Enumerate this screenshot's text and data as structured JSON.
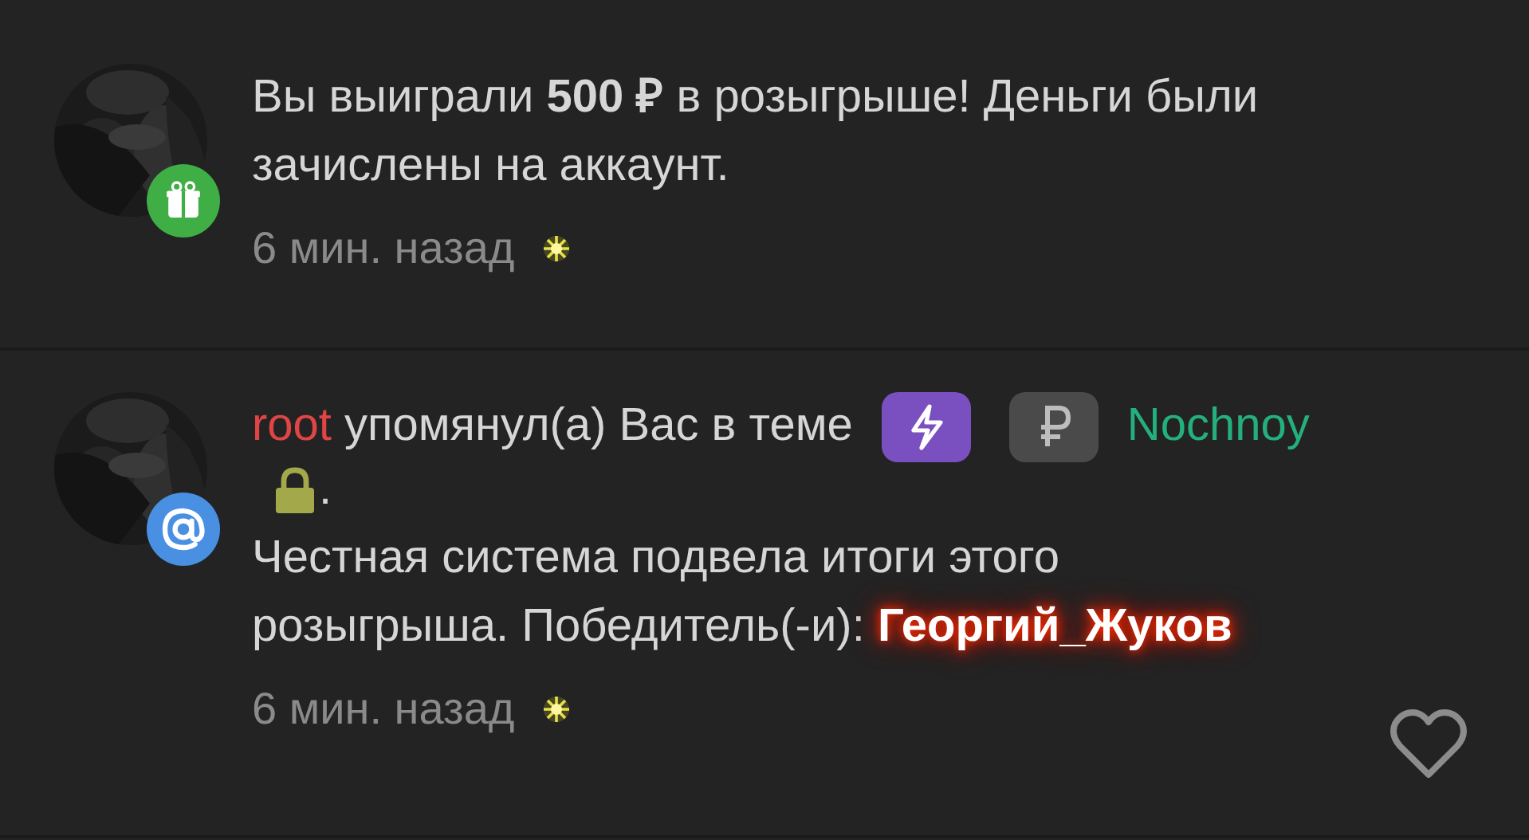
{
  "notifications": [
    {
      "kind": "gift",
      "text": "Вы выиграли **500 ₽** в розыгрыше! Деньги были зачислены на аккаунт.",
      "time": "6 мин. назад",
      "likable": false
    },
    {
      "kind": "mention",
      "author": "root",
      "action": "упомянул(а) Вас в теме",
      "tags": [
        {
          "kind": "lightning"
        },
        {
          "kind": "ruble"
        }
      ],
      "thread": "Nochnoy",
      "locked": true,
      "thread_end": ".",
      "body": "Честная система подвела итоги этого\nрозыгрыша. Победитель(-и): ",
      "winner": "Георгий_Жуков",
      "time": "6 мин. назад",
      "likable": true
    }
  ]
}
